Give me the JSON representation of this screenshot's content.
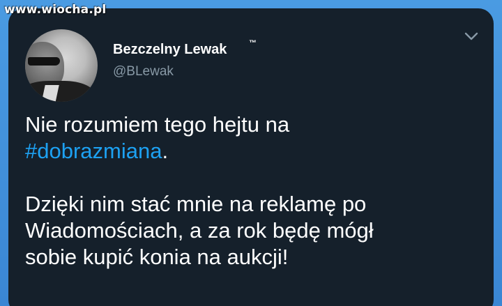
{
  "watermark": "www.wiocha.pl",
  "tweet": {
    "display_name": "Bezczelny Lewak",
    "trademark": "™",
    "handle": "@BLewak",
    "line1": "Nie rozumiem tego hejtu na",
    "hashtag": "#dobrazmiana",
    "after_hashtag": ".",
    "para2_line1": "Dzięki nim stać mnie na reklamę po",
    "para2_line2": "Wiadomościach, a za rok będę mógł",
    "para2_line3": "sobie kupić konia na aukcji!"
  },
  "colors": {
    "card_background": "#15202b",
    "text": "#ffffff",
    "handle": "#8899a6",
    "hashtag": "#1da1f2",
    "frame": "#3a86d4"
  },
  "icons": {
    "more_options": "chevron-down-icon"
  }
}
